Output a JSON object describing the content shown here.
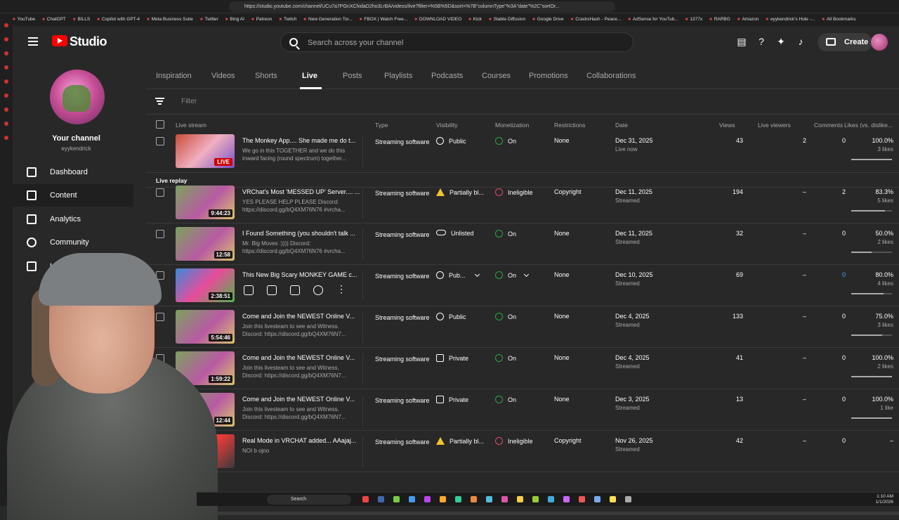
{
  "browser": {
    "url": "https://studio.youtube.com/channel/UCu7a7PGnXChidaD2ho3LrBA/videos/live?filter=%5B%5D&sort=%7B\"columnType\"%3A\"date\"%2C\"sortOr...",
    "bookmarks": [
      "YouTube",
      "ChatGPT",
      "BILLS",
      "Copilot with GPT-4",
      "Meta Business Suite",
      "Twitter",
      "Bing AI",
      "Patreon",
      "Twitch",
      "New Generation Tor...",
      "FBOX | Watch Free...",
      "DOWNLOAD VIDEO",
      "Kick",
      "Stable Diffusion",
      "Google Drive",
      "CracksHash - Peace...",
      "AdSense for YouTub...",
      "1377x",
      "RARBG",
      "Amazon",
      "eyykendrick's Hole -...",
      "All Bookmarks"
    ]
  },
  "header": {
    "logo": "Studio",
    "search_placeholder": "Search across your channel",
    "create_label": "Create"
  },
  "sidebar": {
    "channel_title": "Your channel",
    "channel_handle": "eyykendrick",
    "items": [
      {
        "label": "Dashboard"
      },
      {
        "label": "Content"
      },
      {
        "label": "Analytics"
      },
      {
        "label": "Community"
      },
      {
        "label": "La"
      }
    ]
  },
  "tabs": [
    "Inspiration",
    "Videos",
    "Shorts",
    "Live",
    "Posts",
    "Playlists",
    "Podcasts",
    "Courses",
    "Promotions",
    "Collaborations"
  ],
  "filter_placeholder": "Filter",
  "columns": {
    "live_stream": "Live stream",
    "type": "Type",
    "visibility": "Visibility",
    "monetization": "Monetization",
    "restrictions": "Restrictions",
    "date": "Date",
    "views": "Views",
    "live_viewers": "Live viewers",
    "comments": "Comments",
    "likes": "Likes (vs. dislike..."
  },
  "section_live_replay": "Live replay",
  "rows": [
    {
      "title": "The Monkey App.... She made me do t...",
      "desc": "We go in this TOGETHER and we do this inward facing (round spectrum) together...",
      "badge": "LIVE",
      "type": "Streaming software",
      "visibility": "Public",
      "vis_icon": "globe",
      "monetization": "On",
      "mon_icon": "on",
      "restrictions": "None",
      "date": "Dec 31, 2025",
      "date_sub": "Live now",
      "views": "43",
      "live_viewers": "2",
      "comments": "0",
      "likes_pct": "100.0%",
      "likes_count": "3 likes",
      "likes_fraction": 1.0
    },
    {
      "title": "VRChat's Most 'MESSED UP' Server.... ...",
      "desc": "YES PLEASE HELP PLEASE Discord: https://discord.gg/bQ4XM76N76 #vrcha...",
      "duration": "9:44:23",
      "type": "Streaming software",
      "visibility": "Partially bl...",
      "vis_icon": "warn",
      "monetization": "Ineligible",
      "mon_icon": "off",
      "restrictions": "Copyright",
      "date": "Dec 11, 2025",
      "date_sub": "Streamed",
      "views": "194",
      "live_viewers": "–",
      "comments": "2",
      "likes_pct": "83.3%",
      "likes_count": "5 likes",
      "likes_fraction": 0.833
    },
    {
      "title": "I Found Something (you shouldn't talk ...",
      "desc": "Mr. Big Moves :)))) Discord: https://discord.gg/bQ4XM76N76 #vrcha...",
      "duration": "12:58",
      "type": "Streaming software",
      "visibility": "Unlisted",
      "vis_icon": "link",
      "monetization": "On",
      "mon_icon": "on",
      "restrictions": "None",
      "date": "Dec 11, 2025",
      "date_sub": "Streamed",
      "views": "32",
      "live_viewers": "–",
      "comments": "0",
      "likes_pct": "50.0%",
      "likes_count": "2 likes",
      "likes_fraction": 0.5
    },
    {
      "title": "This New Big Scary MONKEY GAME c...",
      "desc": "",
      "duration": "2:38:51",
      "type": "Streaming software",
      "visibility": "Pub...",
      "vis_icon": "globe",
      "monetization": "On",
      "mon_icon": "on",
      "restrictions": "None",
      "date": "Dec 10, 2025",
      "date_sub": "Streamed",
      "views": "69",
      "live_viewers": "–",
      "comments": "0",
      "comments_blue": true,
      "likes_pct": "80.0%",
      "likes_count": "4 likes",
      "likes_fraction": 0.8,
      "hovered": true
    },
    {
      "title": "Come and Join the NEWEST Online V...",
      "desc": "Join this livesteam to see and Witness. Discord: https://discord.gg/bQ4XM76N7...",
      "duration": "5:54:46",
      "type": "Streaming software",
      "visibility": "Public",
      "vis_icon": "globe",
      "monetization": "On",
      "mon_icon": "on",
      "restrictions": "None",
      "date": "Dec 4, 2025",
      "date_sub": "Streamed",
      "views": "133",
      "live_viewers": "–",
      "comments": "0",
      "likes_pct": "75.0%",
      "likes_count": "3 likes",
      "likes_fraction": 0.75
    },
    {
      "title": "Come and Join the NEWEST Online V...",
      "desc": "Join this livesteam to see and Witness. Discord: https://discord.gg/bQ4XM76N7...",
      "duration": "1:59:22",
      "type": "Streaming software",
      "visibility": "Private",
      "vis_icon": "lock",
      "monetization": "On",
      "mon_icon": "on",
      "restrictions": "None",
      "date": "Dec 4, 2025",
      "date_sub": "Streamed",
      "views": "41",
      "live_viewers": "–",
      "comments": "0",
      "likes_pct": "100.0%",
      "likes_count": "2 likes",
      "likes_fraction": 1.0
    },
    {
      "title": "Come and Join the NEWEST Online V...",
      "desc": "Join this livesteam to see and Witness. Discord: https://discord.gg/bQ4XM76N7...",
      "duration": "12:44",
      "type": "Streaming software",
      "visibility": "Private",
      "vis_icon": "lock",
      "monetization": "On",
      "mon_icon": "on",
      "restrictions": "None",
      "date": "Dec 3, 2025",
      "date_sub": "Streamed",
      "views": "13",
      "live_viewers": "–",
      "comments": "0",
      "likes_pct": "100.0%",
      "likes_count": "1 like",
      "likes_fraction": 1.0
    },
    {
      "title": "Real Mode in VRCHAT added... AAajaj...",
      "desc": "NOI b ojno",
      "duration": "",
      "type": "Streaming software",
      "visibility": "Partially bl...",
      "vis_icon": "warn",
      "monetization": "Ineligible",
      "mon_icon": "off",
      "restrictions": "Copyright",
      "date": "Nov 26, 2025",
      "date_sub": "Streamed",
      "views": "42",
      "live_viewers": "–",
      "comments": "0",
      "likes_pct": "–",
      "likes_count": "",
      "likes_fraction": null
    }
  ],
  "taskbar": {
    "search_label": "Search",
    "time": "1:10 AM",
    "date": "1/1/2026"
  }
}
